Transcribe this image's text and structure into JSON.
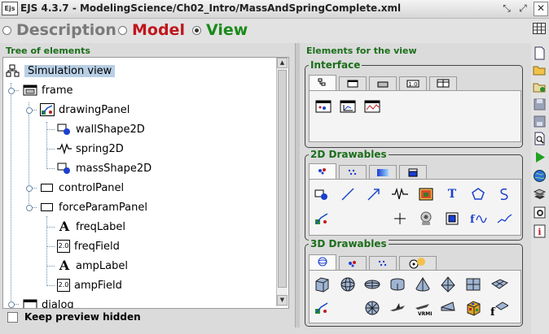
{
  "window": {
    "title": "EJS 4.3.7 - ModelingScience/Ch02_Intro/MassAndSpringComplete.xml",
    "app_icon_text": "Ejs"
  },
  "modes": [
    {
      "label": "Description",
      "color": "#7a7a7a",
      "selected": false
    },
    {
      "label": "Model",
      "color": "#c0161c",
      "selected": false
    },
    {
      "label": "View",
      "color": "#1b8a1b",
      "selected": true
    }
  ],
  "tree_panel": {
    "header": "Tree of elements",
    "nodes": [
      {
        "label": "Simulation view",
        "icon": "simulation-view-icon",
        "selected": true
      },
      {
        "label": "frame",
        "icon": "frame-icon"
      },
      {
        "label": "drawingPanel",
        "icon": "drawing-panel-icon"
      },
      {
        "label": "wallShape2D",
        "icon": "shape2d-icon"
      },
      {
        "label": "spring2D",
        "icon": "spring-icon"
      },
      {
        "label": "massShape2D",
        "icon": "shape2d-icon"
      },
      {
        "label": "controlPanel",
        "icon": "panel-icon"
      },
      {
        "label": "forceParamPanel",
        "icon": "panel-icon"
      },
      {
        "label": "freqLabel",
        "icon": "label-icon"
      },
      {
        "label": "freqField",
        "icon": "number-field-icon"
      },
      {
        "label": "ampLabel",
        "icon": "label-icon"
      },
      {
        "label": "ampField",
        "icon": "number-field-icon"
      },
      {
        "label": "dialog",
        "icon": "dialog-icon"
      }
    ],
    "label_glyph": "A",
    "field_glyph": "2.0",
    "keep_preview_label": "Keep preview hidden"
  },
  "elements_panel": {
    "header": "Elements for the view",
    "groups": [
      {
        "title": "Interface"
      },
      {
        "title": "2D Drawables"
      },
      {
        "title": "3D Drawables"
      }
    ],
    "interface_tab_glyph": "1.0"
  },
  "colors": {
    "accent_green": "#1b6e1b",
    "selection": "#b8cfe5",
    "model_red": "#c0161c"
  }
}
